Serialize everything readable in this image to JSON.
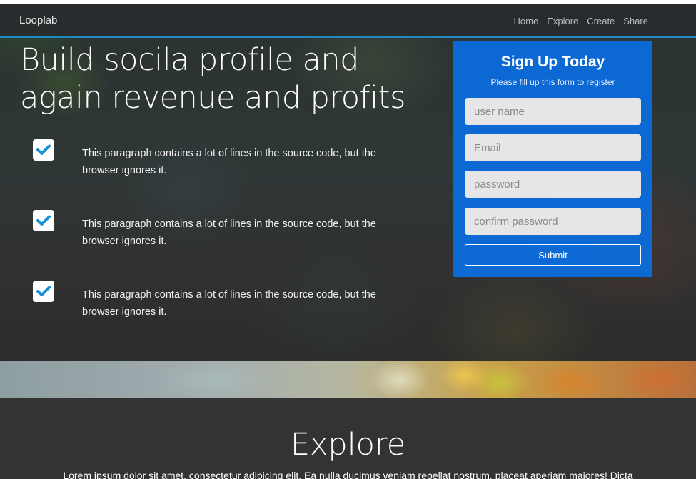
{
  "navbar": {
    "brand": "Looplab",
    "links": [
      "Home",
      "Explore",
      "Create",
      "Share"
    ]
  },
  "hero": {
    "headline": "Build socila profile and again revenue and profits",
    "features": [
      {
        "icon": "check-icon",
        "text": "This paragraph contains a lot of lines in the source code, but the browser ignores it."
      },
      {
        "icon": "check-icon",
        "text": "This paragraph contains a lot of lines in the source code, but the browser ignores it."
      },
      {
        "icon": "check-icon",
        "text": "This paragraph contains a lot of lines in the source code, but the browser ignores it."
      }
    ]
  },
  "signup": {
    "title": "Sign Up Today",
    "subtitle": "Please fill up this form to register",
    "fields": {
      "username": {
        "value": "",
        "placeholder": "user name"
      },
      "email": {
        "value": "",
        "placeholder": "Email"
      },
      "password": {
        "value": "",
        "placeholder": "password"
      },
      "confirm": {
        "value": "",
        "placeholder": "confirm password"
      }
    },
    "submit_label": "Submit"
  },
  "explore": {
    "title": "Explore",
    "text": "Lorem ipsum dolor sit amet, consectetur adipicing elit. Ea nulla ducimus veniam repellat nostrum, placeat aperiam maiores! Dicta"
  },
  "colors": {
    "accent": "#0a6ee1",
    "navbar_border": "#1f8ac0",
    "check": "#1a8fd6",
    "explore_bg": "#333333"
  }
}
